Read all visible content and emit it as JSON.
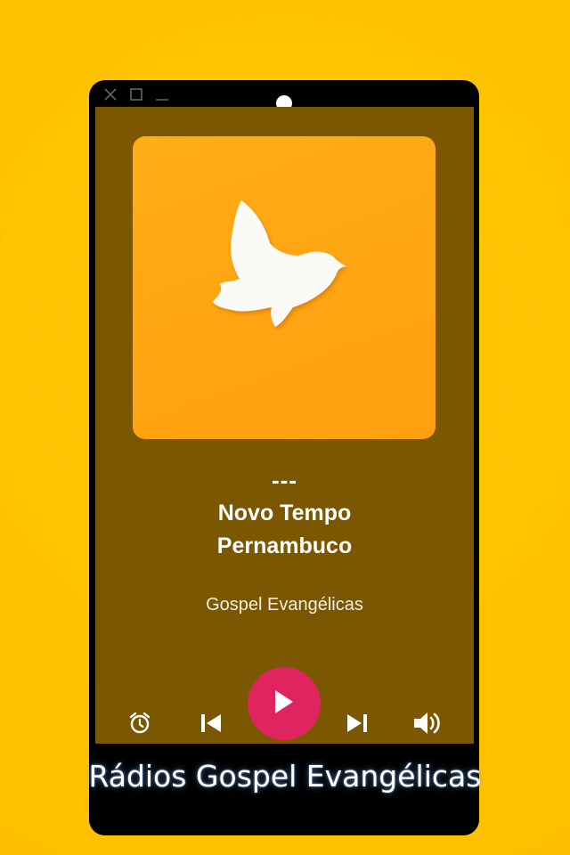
{
  "window": {
    "controls": [
      "close-icon",
      "maximize-icon",
      "minimize-icon"
    ]
  },
  "player": {
    "track_title": "---",
    "station_name": "Novo Tempo Pernambuco",
    "genre": "Gospel Evangélicas",
    "artwork_icon": "dove-icon",
    "controls": {
      "alarm": "alarm-icon",
      "previous": "skip-previous-icon",
      "play": "play-icon",
      "next": "skip-next-icon",
      "volume": "volume-icon"
    }
  },
  "caption": {
    "text": "Rádios Gospel Evangélicas"
  },
  "colors": {
    "background": "#FFC400",
    "screen": "#7A5700",
    "artwork": "#FFA812",
    "play_button": "#E0245F",
    "text": "#FFFFFF"
  }
}
